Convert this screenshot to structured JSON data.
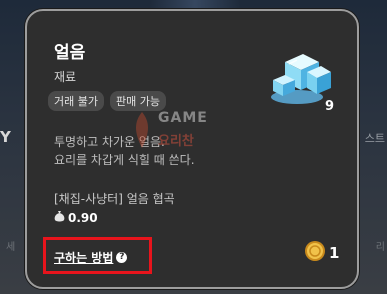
{
  "item": {
    "name": "얼음",
    "category": "재료",
    "tags": [
      "거래 불가",
      "판매 가능"
    ],
    "quantity": "9",
    "description": [
      "투명하고 차가운 얼음.",
      "요리를 차갑게 식힐 때 쓴다."
    ],
    "source": "[채집-사냥터] 얼음 협곡",
    "price": "0.90",
    "icon": "ice-cube-icon"
  },
  "howto": {
    "label": "구하는 방법"
  },
  "reward": {
    "icon": "gold-coin-icon",
    "count": "1"
  },
  "watermark": {
    "line1": "GAME",
    "line2": "요리찬"
  },
  "colors": {
    "highlight_border": "#e8141c",
    "card_bg": "#2e2e2e",
    "card_border": "#9d9d9d"
  }
}
